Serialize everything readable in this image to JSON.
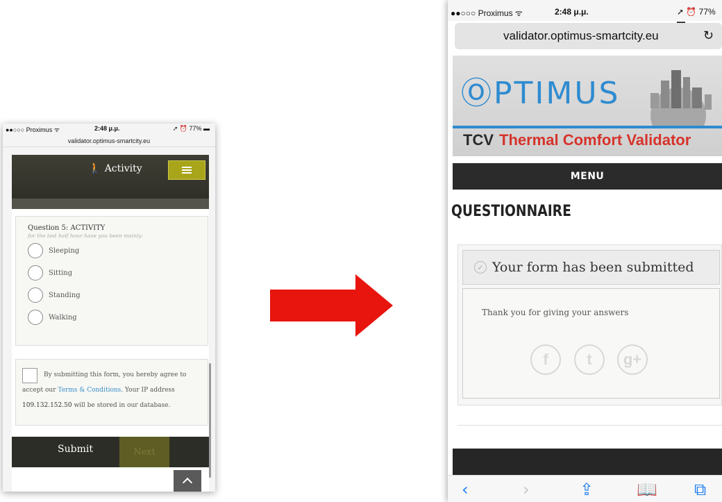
{
  "left_phone": {
    "status": {
      "carrier": "●●○○○ Proximus ᯤ",
      "time": "2:48 μ.μ.",
      "battery": "➚ ⏰ 77% ▬"
    },
    "url": "validator.optimus-smartcity.eu",
    "header": {
      "icon": "🚶",
      "title": "Activity"
    },
    "question": {
      "title": "Question 5: ACTIVITY",
      "subtitle": "for the last half hour have you been mainly:",
      "options": [
        "Sleeping",
        "Sitting",
        "Standing",
        "Walking"
      ]
    },
    "agreement": {
      "pre": "By submitting this form, you hereby agree to accept our ",
      "link": "Terms & Conditions",
      "mid": ". Your IP address ",
      "ip": "109.132.152.50",
      "post": " will be stored in our database."
    },
    "footer": {
      "submit": "Submit",
      "next": "Next"
    }
  },
  "right_phone": {
    "status": {
      "carrier": "●●○○○ Proximus ᯤ",
      "time": "2:48 μ.μ.",
      "battery": "➚ ⏰ 77% ▬"
    },
    "url": "validator.optimus-smartcity.eu",
    "reload_icon": "↻",
    "logo": "ⓄPTIMUS",
    "tcv_prefix": "TCV",
    "tcv_title": "Thermal Comfort Validator",
    "menu": "MENU",
    "heading": "QUESTIONNAIRE",
    "submitted_check": "✓",
    "submitted": "Your form has been submitted",
    "thanks": "Thank you for giving your answers",
    "social": {
      "facebook": "f",
      "twitter": "t",
      "googleplus": "g+"
    },
    "toolbar": {
      "back": "‹",
      "forward": "›",
      "share": "⇪",
      "bookmarks": "📖",
      "tabs": "⧉"
    }
  },
  "colors": {
    "accent_blue": "#2e8bd0",
    "accent_red": "#d6332b",
    "olive": "#a8a51a",
    "arrow_red": "#e8150f"
  }
}
